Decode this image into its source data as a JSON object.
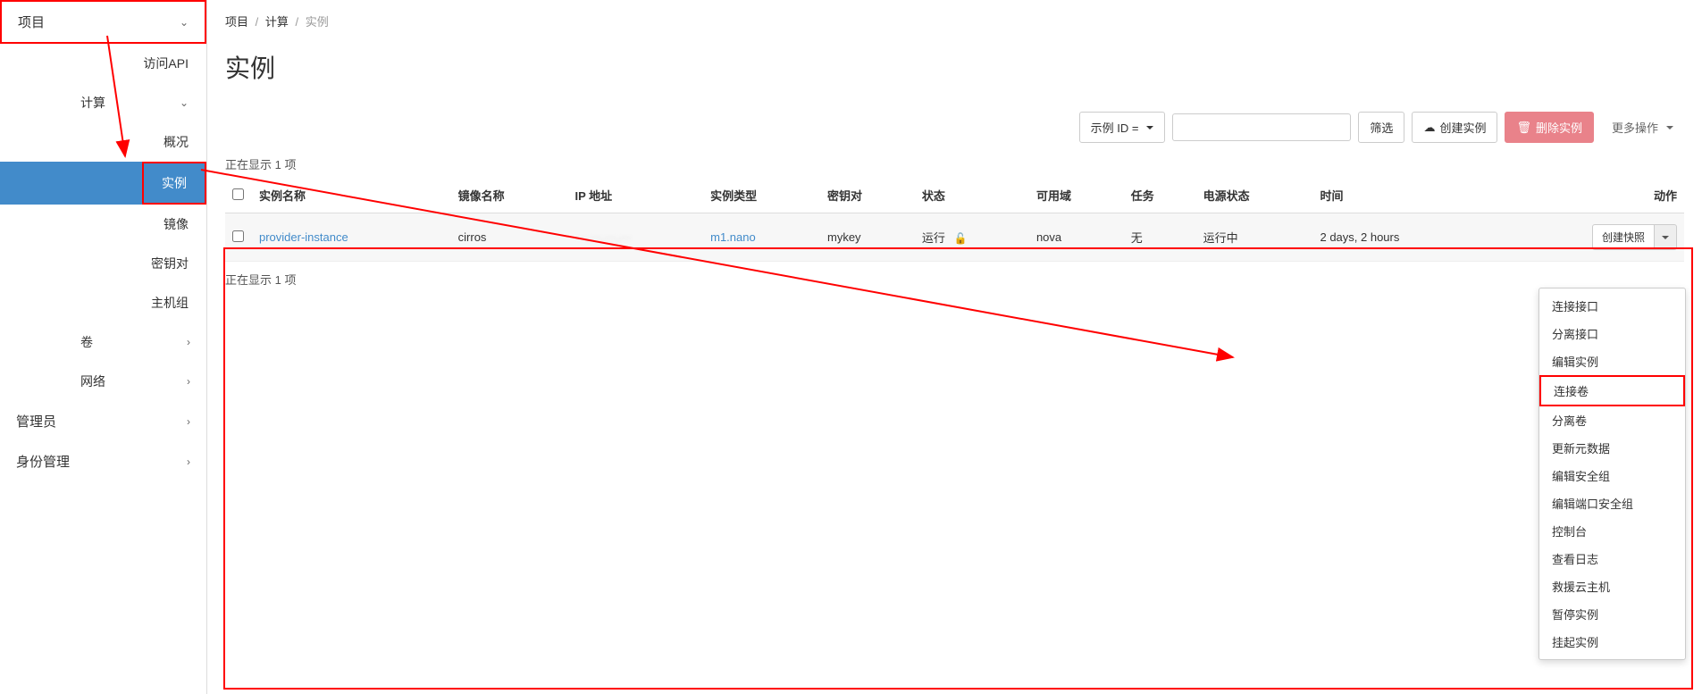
{
  "sidebar": {
    "top": "项目",
    "api": "访问API",
    "compute": "计算",
    "overview": "概况",
    "instances": "实例",
    "images": "镜像",
    "keypairs": "密钥对",
    "hostgroups": "主机组",
    "volumes": "卷",
    "network": "网络",
    "admin": "管理员",
    "identity": "身份管理"
  },
  "breadcrumb": {
    "project": "项目",
    "compute": "计算",
    "current": "实例"
  },
  "page_title": "实例",
  "toolbar": {
    "filter_label": "示例 ID =",
    "filter_btn": "筛选",
    "create_btn": "创建实例",
    "delete_btn": "删除实例",
    "more_btn": "更多操作"
  },
  "showing_text": "正在显示 1 项",
  "table": {
    "headers": {
      "name": "实例名称",
      "image": "镜像名称",
      "ip": "IP 地址",
      "flavor": "实例类型",
      "keypair": "密钥对",
      "status": "状态",
      "zone": "可用域",
      "task": "任务",
      "power": "电源状态",
      "time": "时间",
      "action": "动作"
    },
    "row": {
      "name": "provider-instance",
      "image": "cirros",
      "ip": "···.···.···.···",
      "flavor": "m1.nano",
      "keypair": "mykey",
      "status": "运行",
      "zone": "nova",
      "task": "无",
      "power": "运行中",
      "time": "2 days, 2 hours",
      "action_btn": "创建快照"
    }
  },
  "dropdown": {
    "items": [
      "连接接口",
      "分离接口",
      "编辑实例",
      "连接卷",
      "分离卷",
      "更新元数据",
      "编辑安全组",
      "编辑端口安全组",
      "控制台",
      "查看日志",
      "救援云主机",
      "暂停实例",
      "挂起实例"
    ],
    "highlight_index": 3
  }
}
